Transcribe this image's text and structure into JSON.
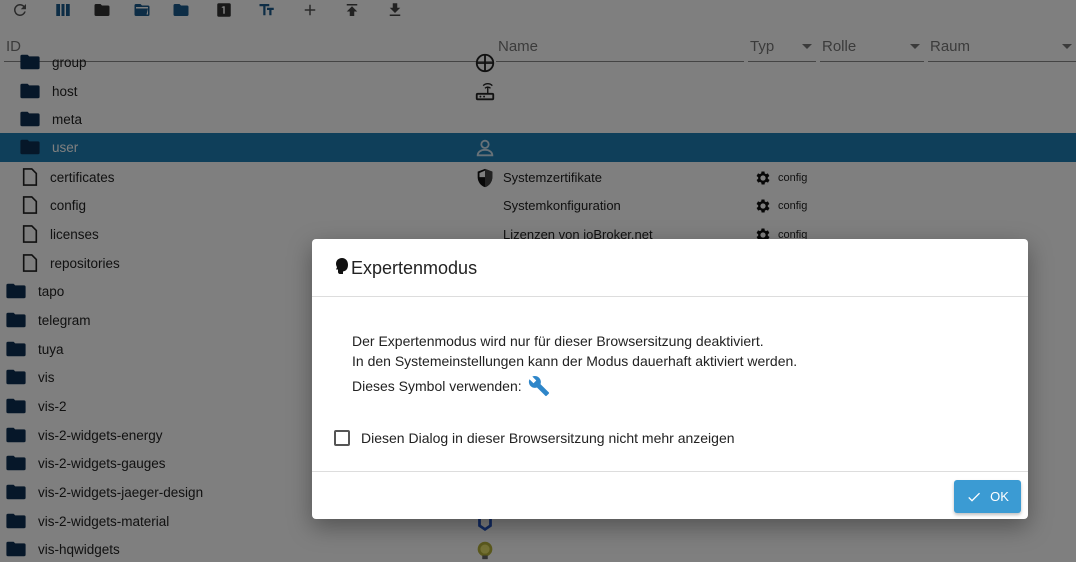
{
  "toolbar": {
    "items": [
      "refresh-icon",
      "columns-icon",
      "folder-icon",
      "folder-open-icon",
      "folder-closed-icon",
      "number-one-icon",
      "text-format-icon",
      "add-icon",
      "upload-icon",
      "download-icon"
    ]
  },
  "header": {
    "id_label": "ID",
    "name_label": "Name",
    "type_label": "Typ",
    "role_label": "Rolle",
    "room_label": "Raum"
  },
  "tree": {
    "rows": [
      {
        "label": "group",
        "kind": "folder"
      },
      {
        "label": "host",
        "kind": "folder"
      },
      {
        "label": "meta",
        "kind": "folder"
      },
      {
        "label": "user",
        "kind": "folder",
        "selected": true
      },
      {
        "label": "certificates",
        "kind": "file",
        "name": "Systemzertifikate",
        "role": "config"
      },
      {
        "label": "config",
        "kind": "file",
        "name": "Systemkonfiguration",
        "role": "config"
      },
      {
        "label": "licenses",
        "kind": "file",
        "name": "Lizenzen von ioBroker.net",
        "role": "config"
      },
      {
        "label": "repositories",
        "kind": "file"
      },
      {
        "label": "tapo",
        "kind": "folder"
      },
      {
        "label": "telegram",
        "kind": "folder"
      },
      {
        "label": "tuya",
        "kind": "folder"
      },
      {
        "label": "vis",
        "kind": "folder"
      },
      {
        "label": "vis-2",
        "kind": "folder"
      },
      {
        "label": "vis-2-widgets-energy",
        "kind": "folder"
      },
      {
        "label": "vis-2-widgets-gauges",
        "kind": "folder"
      },
      {
        "label": "vis-2-widgets-jaeger-design",
        "kind": "folder"
      },
      {
        "label": "vis-2-widgets-material",
        "kind": "folder"
      },
      {
        "label": "vis-hqwidgets",
        "kind": "folder"
      }
    ]
  },
  "dialog": {
    "title": "Expertenmodus",
    "line1": "Der Expertenmodus wird nur für dieser Browsersitzung deaktiviert.",
    "line2": "In den Systemeinstellungen kann der Modus dauerhaft aktiviert werden.",
    "line3": "Dieses Symbol verwenden:",
    "checkbox_label": "Diesen Dialog in dieser Browsersitzung nicht mehr anzeigen",
    "checkbox_checked": false,
    "ok_label": "OK"
  },
  "colors": {
    "accent": "#3b9bd3",
    "selected_row": "#1f7fb4",
    "folder": "#0d2f52",
    "toolbar_icon": "#1a5b8c"
  }
}
